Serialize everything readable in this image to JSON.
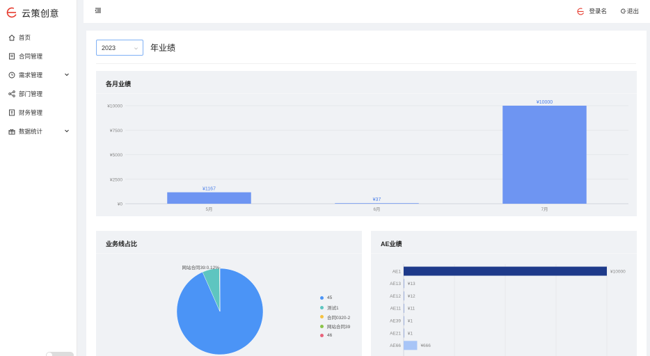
{
  "brand": {
    "name": "云策创意",
    "accent": "#e63b2e"
  },
  "sidebar": {
    "items": [
      {
        "label": "首页",
        "icon": "home-icon",
        "chevron": false
      },
      {
        "label": "合同管理",
        "icon": "document-icon",
        "chevron": false
      },
      {
        "label": "需求管理",
        "icon": "clock-icon",
        "chevron": true
      },
      {
        "label": "部门管理",
        "icon": "share-icon",
        "chevron": false
      },
      {
        "label": "财务管理",
        "icon": "ledger-icon",
        "chevron": false
      },
      {
        "label": "数据统计",
        "icon": "gift-icon",
        "chevron": true
      }
    ]
  },
  "header": {
    "username": "登录名",
    "logout_label": "退出"
  },
  "filter": {
    "year": "2023"
  },
  "page": {
    "title": "年业绩"
  },
  "cards": {
    "monthly": {
      "title": "各月业绩"
    },
    "business": {
      "title": "业务线占比"
    },
    "ae": {
      "title": "AE业绩"
    }
  },
  "colors": {
    "bar": "#6e95f2",
    "ae_top": "#1e3a8a",
    "ae_light": "#a8c5f7",
    "pie_main": "#4b94f6",
    "pie_teal": "#5ec5c0"
  },
  "chart_data": [
    {
      "type": "bar",
      "title": "各月业绩",
      "categories": [
        "5月",
        "6月",
        "7月"
      ],
      "values": [
        1167,
        37,
        10000
      ],
      "value_labels": [
        "¥1167",
        "¥37",
        "¥10000"
      ],
      "ylim": [
        0,
        10000
      ],
      "yticks": [
        0,
        2500,
        5000,
        7500,
        10000
      ],
      "ytick_labels": [
        "¥0",
        "¥2500",
        "¥5000",
        "¥7500",
        "¥10000"
      ],
      "grid": true
    },
    {
      "type": "pie",
      "title": "业务线占比",
      "labels": [
        "45",
        "测试1",
        "合同0320-2",
        "网站合同39",
        "46"
      ],
      "legend_colors": [
        "#4b94f6",
        "#5ec5c0",
        "#f5c242",
        "#8bc34a",
        "#e8637b"
      ],
      "values": [
        93.4,
        6.4,
        0.1,
        0.1,
        0.0
      ],
      "overlapping_label": "网站合同39:0.12%",
      "legend": "right"
    },
    {
      "type": "bar",
      "orientation": "horizontal",
      "title": "AE业绩",
      "categories": [
        "AE1",
        "AE13",
        "AE12",
        "AE11",
        "AE39",
        "AE21",
        "AE66"
      ],
      "values": [
        10000,
        13,
        12,
        11,
        1,
        1,
        666
      ],
      "value_labels": [
        "¥10000",
        "¥13",
        "¥12",
        "¥11",
        "¥1",
        "¥1",
        "¥666"
      ],
      "xlim": [
        0,
        10000
      ],
      "grid": true
    }
  ]
}
